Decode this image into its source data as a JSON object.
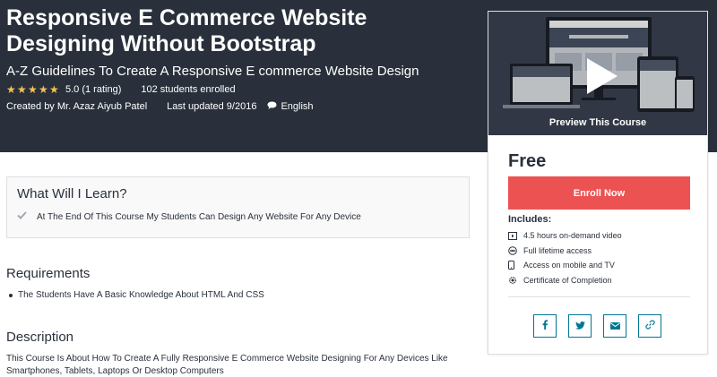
{
  "course": {
    "title": "Responsive E Commerce Website Designing Without Bootstrap",
    "subtitle": "A-Z Guidelines To Create A Responsive E commerce Website Design",
    "stars": 5,
    "rating_text": "5.0 (1 rating)",
    "students": "102 students enrolled",
    "created_by": "Created by Mr. Azaz Aiyub Patel",
    "last_updated": "Last updated 9/2016",
    "language": "English"
  },
  "learn": {
    "title": "What Will I Learn?",
    "items": [
      "At The End Of This Course My Students Can Design Any Website For Any Device"
    ]
  },
  "requirements": {
    "title": "Requirements",
    "items": [
      "The Students Have A Basic Knowledge About HTML And CSS"
    ]
  },
  "description": {
    "title": "Description",
    "text": "This Course Is About How To Create A Fully Responsive E Commerce Website Designing For Any Devices Like Smartphones, Tablets, Laptops Or Desktop Computers"
  },
  "sidebar": {
    "preview_label": "Preview This Course",
    "price": "Free",
    "enroll_label": "Enroll Now",
    "includes_title": "Includes:",
    "includes": [
      {
        "icon": "video-icon",
        "label": "4.5 hours on-demand video"
      },
      {
        "icon": "infinity-icon",
        "label": "Full lifetime access"
      },
      {
        "icon": "mobile-icon",
        "label": "Access on mobile and TV"
      },
      {
        "icon": "certificate-icon",
        "label": "Certificate of Completion"
      }
    ],
    "share": [
      "facebook-icon",
      "twitter-icon",
      "email-icon",
      "link-icon"
    ]
  },
  "colors": {
    "hero_bg": "#29303b",
    "star": "#f4c150",
    "enroll": "#ec5252",
    "share_accent": "#007791"
  }
}
